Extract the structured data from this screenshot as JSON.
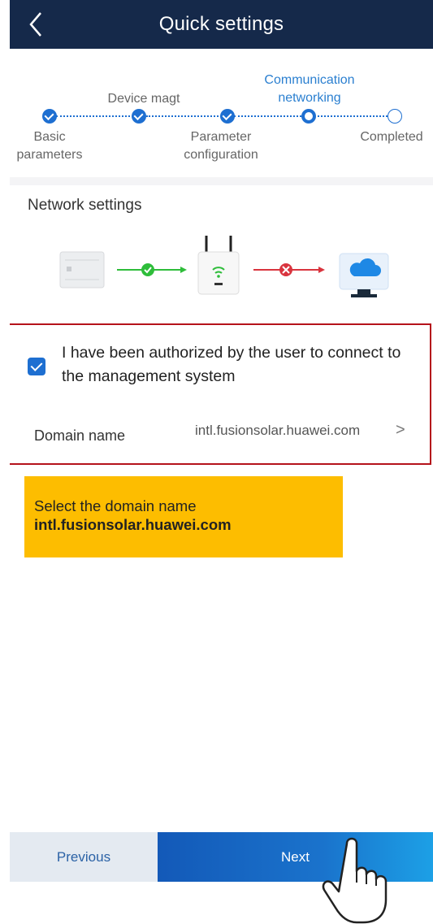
{
  "header": {
    "title": "Quick settings"
  },
  "stepper": {
    "steps": [
      {
        "label": "Basic parameters",
        "status": "done"
      },
      {
        "label": "Device magt",
        "status": "done"
      },
      {
        "label": "Parameter configuration",
        "status": "done"
      },
      {
        "label": "Communication networking",
        "status": "current"
      },
      {
        "label": "Completed",
        "status": "todo"
      }
    ]
  },
  "network": {
    "section_title": "Network settings",
    "diagram_icons": [
      "inverter-icon",
      "router-icon",
      "cloud-monitor-icon"
    ],
    "link_status": [
      "connected",
      "disconnected"
    ]
  },
  "authorization": {
    "checked": true,
    "text": "I have been authorized by the user to connect to the management system"
  },
  "domain": {
    "label": "Domain name",
    "value": "intl.fusionsolar.huawei.com",
    "chevron": ">"
  },
  "note": {
    "line1": "Select the domain name",
    "line2": "intl.fusionsolar.huawei.com"
  },
  "footer": {
    "previous_label": "Previous",
    "next_label": "Next"
  },
  "colors": {
    "header_bg": "#15294a",
    "accent": "#1e6fd1",
    "highlight_border": "#b5121b",
    "note_bg": "#fdbd00",
    "ok_green": "#2ebd3a",
    "error_red": "#d9343e"
  }
}
